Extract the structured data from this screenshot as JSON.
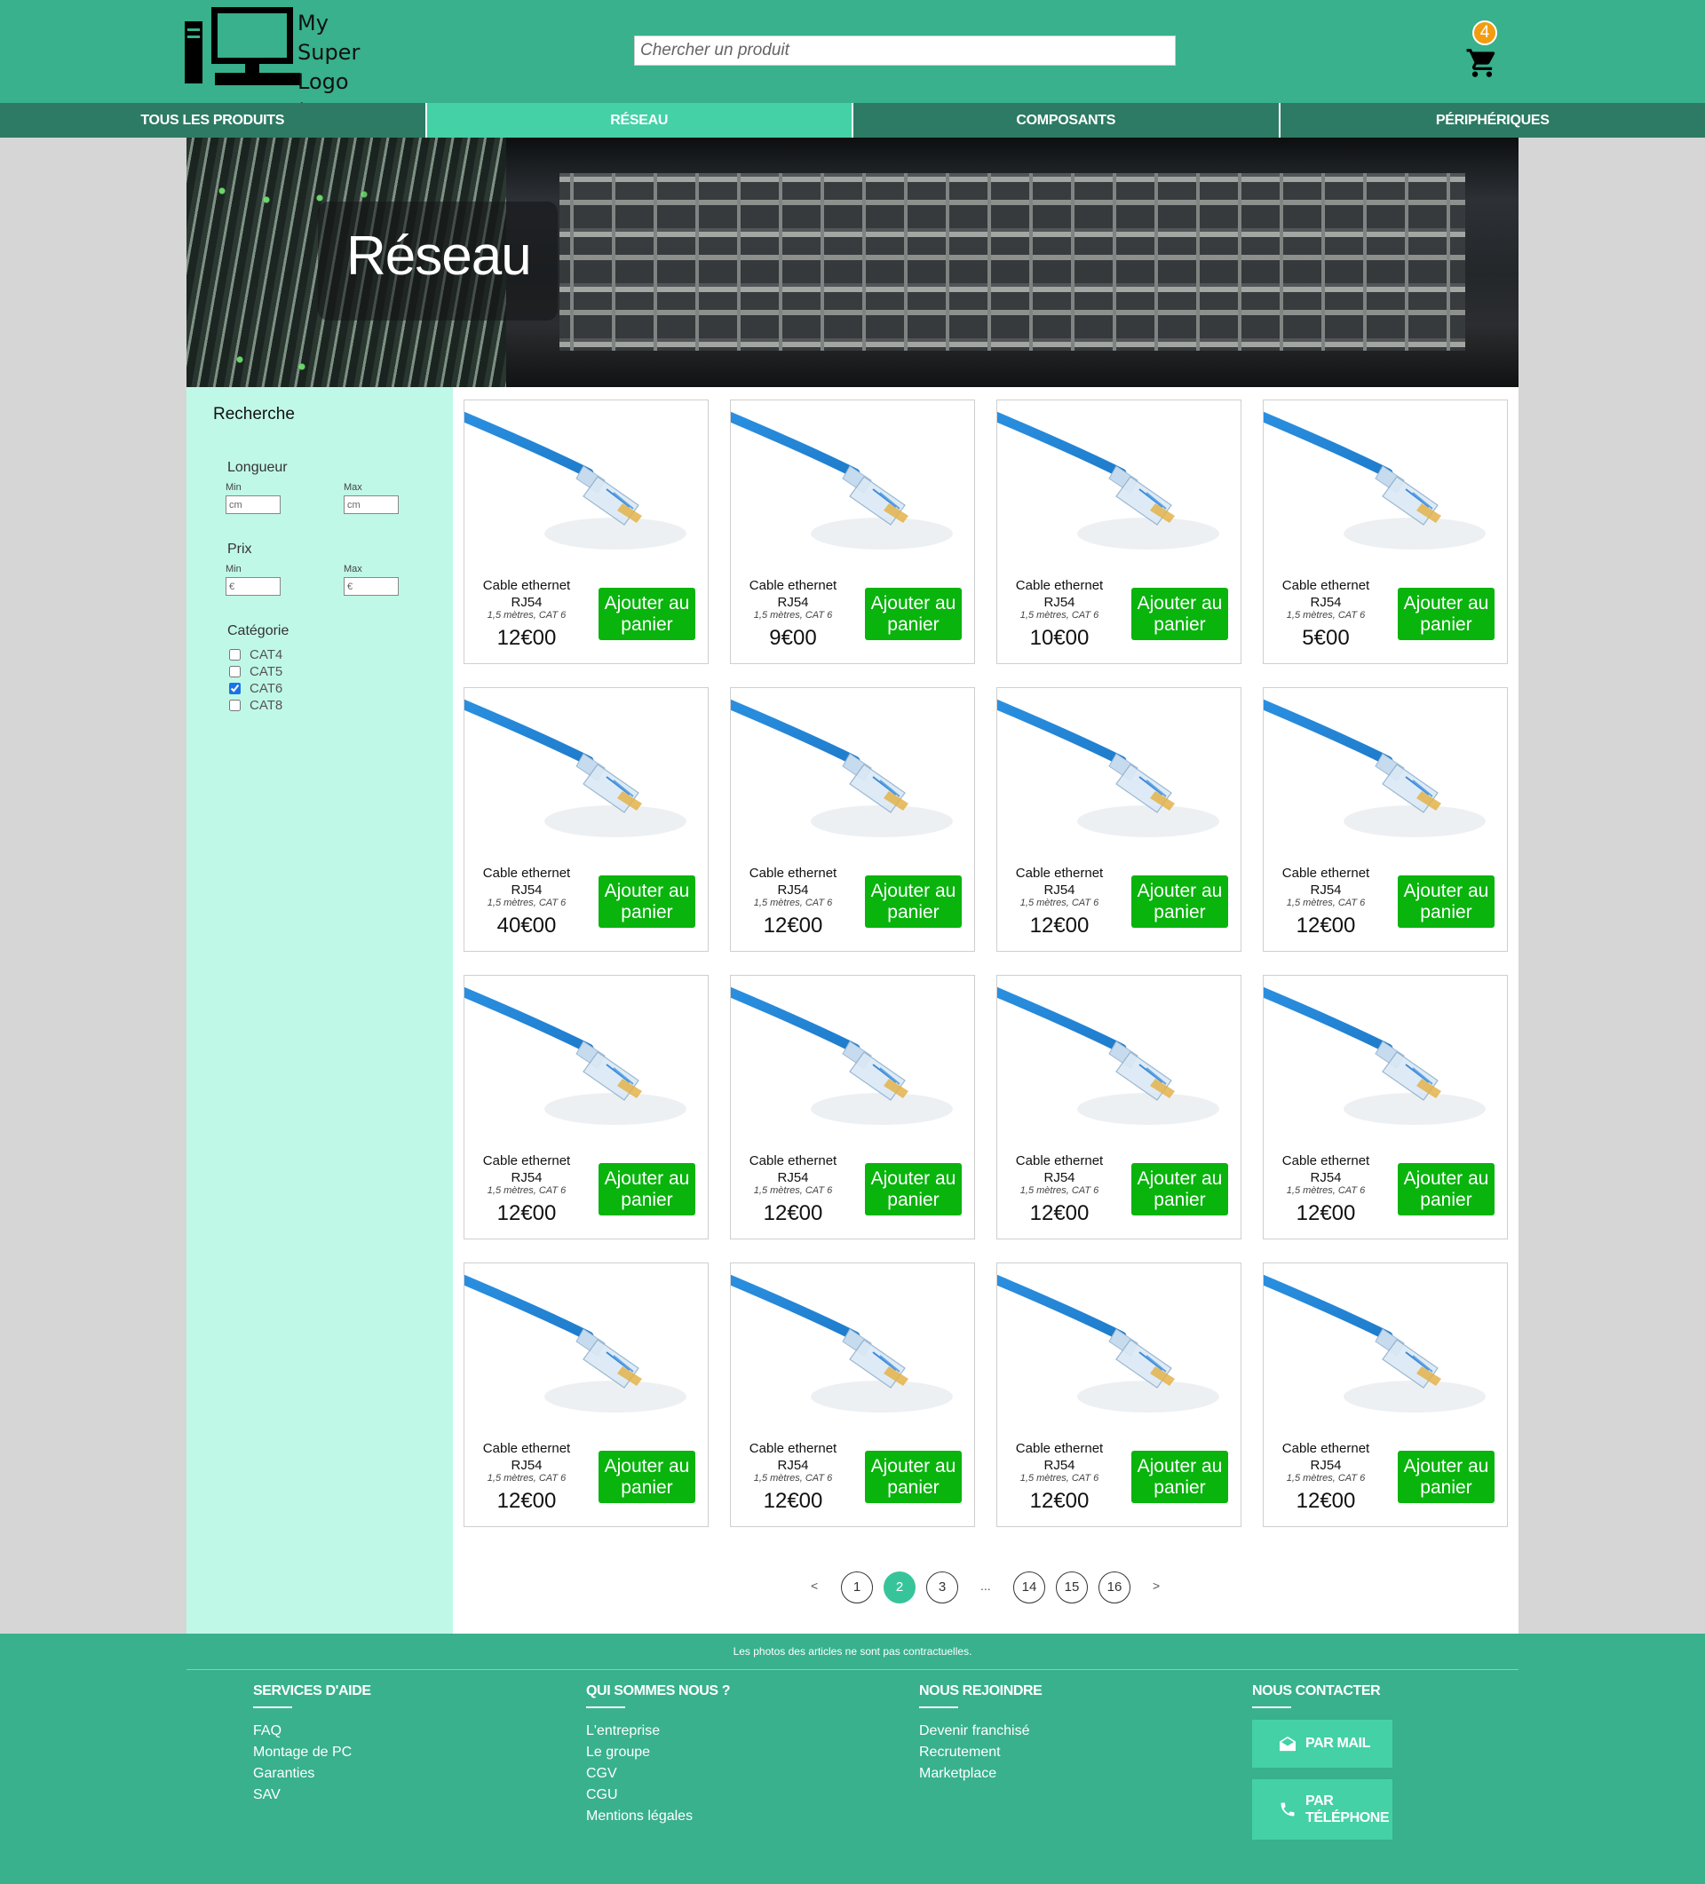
{
  "header": {
    "logo_text": "My\nSuper\nLogo !",
    "search_placeholder": "Chercher un produit",
    "cart_count": "4"
  },
  "nav": {
    "tabs": [
      {
        "label": "TOUS LES PRODUITS",
        "active": false
      },
      {
        "label": "RÉSEAU",
        "active": true
      },
      {
        "label": "COMPOSANTS",
        "active": false
      },
      {
        "label": "PÉRIPHÉRIQUES",
        "active": false
      }
    ]
  },
  "banner": {
    "title": "Réseau"
  },
  "sidebar": {
    "title": "Recherche",
    "length": {
      "label": "Longueur",
      "min_label": "Min",
      "max_label": "Max",
      "min_placeholder": "cm",
      "max_placeholder": "cm"
    },
    "price": {
      "label": "Prix",
      "min_label": "Min",
      "max_label": "Max",
      "min_placeholder": "€",
      "max_placeholder": "€"
    },
    "category": {
      "label": "Catégorie",
      "options": [
        {
          "label": "CAT4",
          "checked": false
        },
        {
          "label": "CAT5",
          "checked": false
        },
        {
          "label": "CAT6",
          "checked": true
        },
        {
          "label": "CAT8",
          "checked": false
        }
      ]
    }
  },
  "products": [
    {
      "name": "Cable ethernet RJ54",
      "desc": "1,5 mètres, CAT 6",
      "price": "12€00",
      "button": "Ajouter au panier"
    },
    {
      "name": "Cable ethernet RJ54",
      "desc": "1,5 mètres, CAT 6",
      "price": "9€00",
      "button": "Ajouter au panier"
    },
    {
      "name": "Cable ethernet RJ54",
      "desc": "1,5 mètres, CAT 6",
      "price": "10€00",
      "button": "Ajouter au panier"
    },
    {
      "name": "Cable ethernet RJ54",
      "desc": "1,5 mètres, CAT 6",
      "price": "5€00",
      "button": "Ajouter au panier"
    },
    {
      "name": "Cable ethernet RJ54",
      "desc": "1,5 mètres, CAT 6",
      "price": "40€00",
      "button": "Ajouter au panier"
    },
    {
      "name": "Cable ethernet RJ54",
      "desc": "1,5 mètres, CAT 6",
      "price": "12€00",
      "button": "Ajouter au panier"
    },
    {
      "name": "Cable ethernet RJ54",
      "desc": "1,5 mètres, CAT 6",
      "price": "12€00",
      "button": "Ajouter au panier"
    },
    {
      "name": "Cable ethernet RJ54",
      "desc": "1,5 mètres, CAT 6",
      "price": "12€00",
      "button": "Ajouter au panier"
    },
    {
      "name": "Cable ethernet RJ54",
      "desc": "1,5 mètres, CAT 6",
      "price": "12€00",
      "button": "Ajouter au panier"
    },
    {
      "name": "Cable ethernet RJ54",
      "desc": "1,5 mètres, CAT 6",
      "price": "12€00",
      "button": "Ajouter au panier"
    },
    {
      "name": "Cable ethernet RJ54",
      "desc": "1,5 mètres, CAT 6",
      "price": "12€00",
      "button": "Ajouter au panier"
    },
    {
      "name": "Cable ethernet RJ54",
      "desc": "1,5 mètres, CAT 6",
      "price": "12€00",
      "button": "Ajouter au panier"
    },
    {
      "name": "Cable ethernet RJ54",
      "desc": "1,5 mètres, CAT 6",
      "price": "12€00",
      "button": "Ajouter au panier"
    },
    {
      "name": "Cable ethernet RJ54",
      "desc": "1,5 mètres, CAT 6",
      "price": "12€00",
      "button": "Ajouter au panier"
    },
    {
      "name": "Cable ethernet RJ54",
      "desc": "1,5 mètres, CAT 6",
      "price": "12€00",
      "button": "Ajouter au panier"
    },
    {
      "name": "Cable ethernet RJ54",
      "desc": "1,5 mètres, CAT 6",
      "price": "12€00",
      "button": "Ajouter au panier"
    }
  ],
  "pagination": {
    "prev": "<",
    "next": ">",
    "ellipsis": "...",
    "pages": [
      {
        "label": "1",
        "active": false
      },
      {
        "label": "2",
        "active": true
      },
      {
        "label": "3",
        "active": false
      },
      {
        "label": "14",
        "active": false
      },
      {
        "label": "15",
        "active": false
      },
      {
        "label": "16",
        "active": false
      }
    ]
  },
  "footer": {
    "disclaimer": "Les photos des articles ne sont pas contractuelles.",
    "columns": [
      {
        "title": "SERVICES D'AIDE",
        "links": [
          "FAQ",
          "Montage de PC",
          "Garanties",
          "SAV"
        ]
      },
      {
        "title": "QUI SOMMES NOUS ?",
        "links": [
          "L'entreprise",
          "Le groupe",
          "CGV",
          "CGU",
          "Mentions légales"
        ]
      },
      {
        "title": "NOUS REJOINDRE",
        "links": [
          "Devenir franchisé",
          "Recrutement",
          "Marketplace"
        ]
      },
      {
        "title": "NOUS CONTACTER",
        "links": []
      }
    ],
    "contact_mail": "PAR MAIL",
    "contact_phone_line1": "PAR",
    "contact_phone_line2": "TÉLÉPHONE"
  },
  "colors": {
    "header_bg": "#38b18c",
    "nav_bg": "#2d7b64",
    "nav_active": "#44d1a6",
    "sidebar_bg": "#c0f8e8",
    "add_button": "#09b40d",
    "cart_badge": "#f39c12"
  },
  "icons": [
    "computer-logo-icon",
    "cart-icon",
    "cable-image",
    "mail-icon",
    "phone-icon"
  ]
}
